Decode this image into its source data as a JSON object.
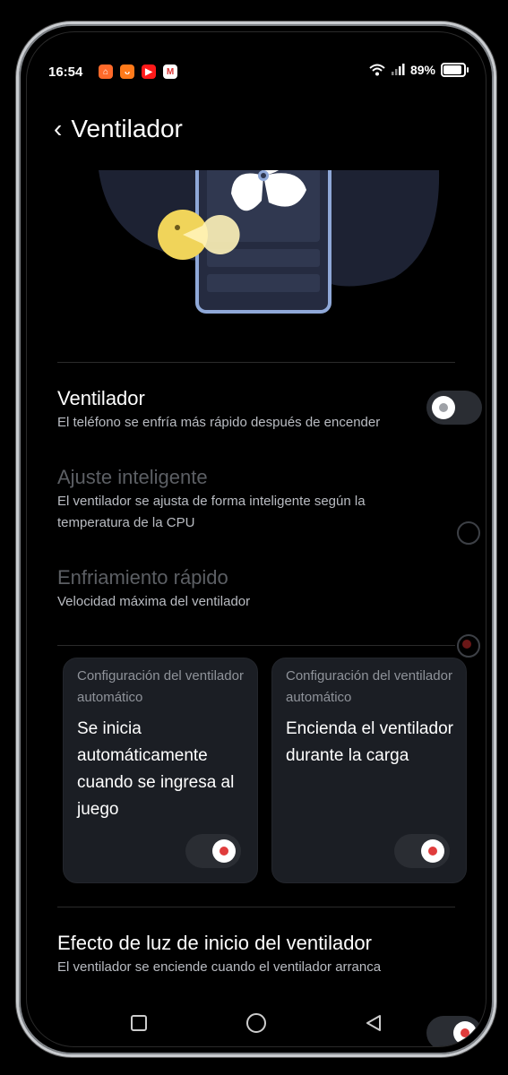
{
  "status": {
    "time": "16:54",
    "battery": "89%",
    "battery_level": 0.89,
    "apps": [
      "shopping-bag-icon",
      "temu-icon",
      "youtube-icon",
      "gmail-icon"
    ]
  },
  "header": {
    "back_icon": "chevron-left-icon",
    "title": "Ventilador"
  },
  "settings": {
    "fan": {
      "title": "Ventilador",
      "subtitle": "El teléfono se enfría más rápido después de encender",
      "enabled": false
    },
    "smart": {
      "title": "Ajuste inteligente",
      "subtitle": "El ventilador se ajusta de forma inteligente según la temperatura de la CPU",
      "selected": false
    },
    "fast": {
      "title": "Enfriamiento rápido",
      "subtitle": "Velocidad máxima del ventilador",
      "selected": true
    }
  },
  "cards": [
    {
      "label": "Configuración del ventilador automático",
      "text": "Se inicia automáticamente cuando se ingresa al juego",
      "enabled": true
    },
    {
      "label": "Configuración del ventilador automático",
      "text": "Encienda el ventilador durante la carga",
      "enabled": true
    }
  ],
  "light_effect": {
    "title": "Efecto de luz de inicio del ventilador",
    "subtitle": "El ventilador se enciende cuando el ventilador arranca",
    "enabled": true
  },
  "colors": {
    "accent": "#e03c3c",
    "card": "#1b1e24",
    "illustration_blob": "#1d2233",
    "phone_outline": "#8fa8d8",
    "coin": "#f0d45a"
  }
}
